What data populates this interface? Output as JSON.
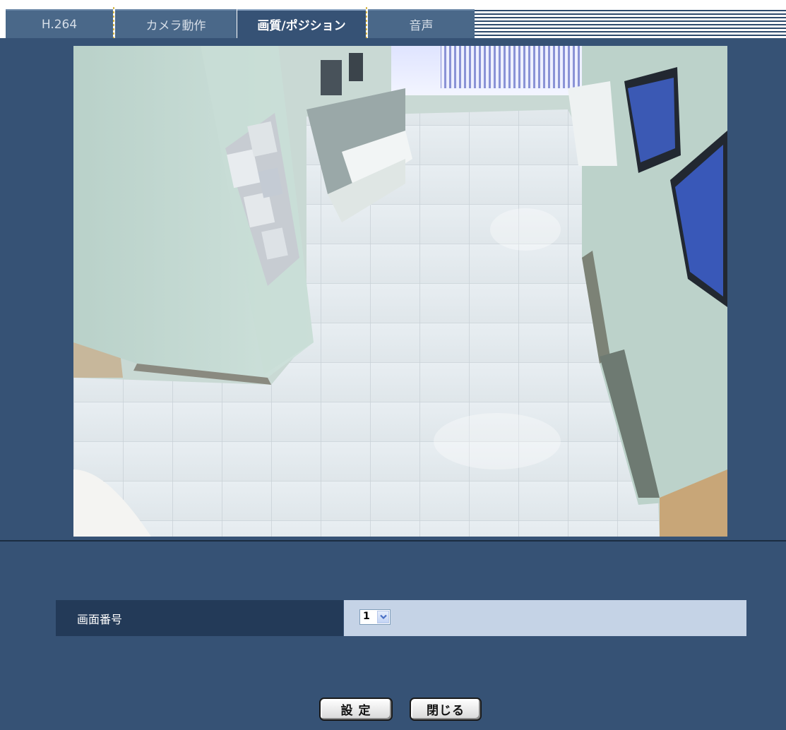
{
  "tabs": [
    {
      "label": "H.264"
    },
    {
      "label": "カメラ動作"
    },
    {
      "label": "画質/ポジション"
    },
    {
      "label": "音声"
    }
  ],
  "active_tab": "画質/ポジション",
  "setting": {
    "label": "画面番号",
    "selected_value": "1"
  },
  "buttons": {
    "set": "設 定",
    "close": "閉じる"
  },
  "colors": {
    "background": "#365275",
    "label_cell": "#233a58",
    "value_cell": "#c5d3e6"
  },
  "icons": {
    "dropdown": "chevron-down-icon"
  }
}
